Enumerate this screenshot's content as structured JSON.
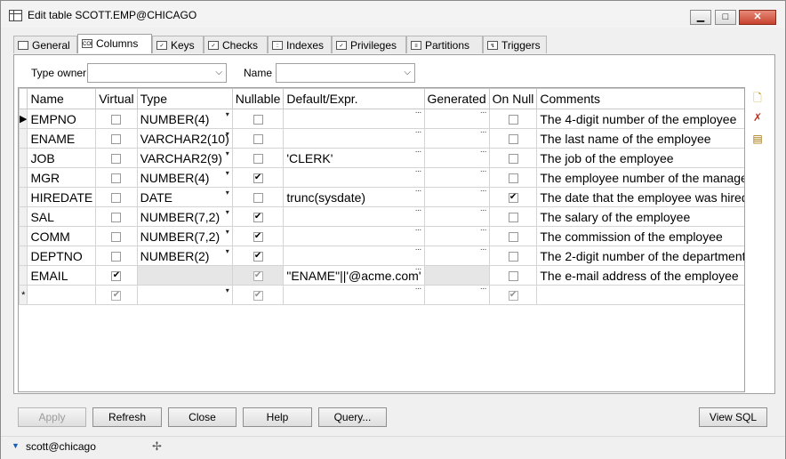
{
  "window": {
    "title": "Edit table SCOTT.EMP@CHICAGO",
    "minimize": "▁",
    "maximize": "□",
    "close": "✕"
  },
  "tabs": [
    {
      "label": "General",
      "icon": "general-icon",
      "glyph": ""
    },
    {
      "label": "Columns",
      "icon": "columns-icon",
      "glyph": "COL"
    },
    {
      "label": "Keys",
      "icon": "keys-icon",
      "glyph": "✓"
    },
    {
      "label": "Checks",
      "icon": "checks-icon",
      "glyph": "✓"
    },
    {
      "label": "Indexes",
      "icon": "indexes-icon",
      "glyph": "::"
    },
    {
      "label": "Privileges",
      "icon": "privileges-icon",
      "glyph": "✓"
    },
    {
      "label": "Partitions",
      "icon": "partitions-icon",
      "glyph": "≡"
    },
    {
      "label": "Triggers",
      "icon": "triggers-icon",
      "glyph": "↯"
    }
  ],
  "filters": {
    "type_owner_label": "Type owner",
    "type_owner_value": "",
    "name_label": "Name",
    "name_value": ""
  },
  "grid": {
    "headers": [
      "Name",
      "Virtual",
      "Type",
      "Nullable",
      "Default/Expr.",
      "Generated",
      "On Null",
      "Comments"
    ],
    "rows": [
      {
        "indicator": "▶",
        "name": "EMPNO",
        "virtual": false,
        "type": "NUMBER(4)",
        "nullable": false,
        "default": "",
        "generated": "",
        "on_null": false,
        "comments": "The 4-digit number of the employee"
      },
      {
        "indicator": "",
        "name": "ENAME",
        "virtual": false,
        "type": "VARCHAR2(10)",
        "nullable": false,
        "default": "",
        "generated": "",
        "on_null": false,
        "comments": "The last name of the employee"
      },
      {
        "indicator": "",
        "name": "JOB",
        "virtual": false,
        "type": "VARCHAR2(9)",
        "nullable": false,
        "default": "'CLERK'",
        "generated": "",
        "on_null": false,
        "comments": "The job of the employee"
      },
      {
        "indicator": "",
        "name": "MGR",
        "virtual": false,
        "type": "NUMBER(4)",
        "nullable": true,
        "default": "",
        "generated": "",
        "on_null": false,
        "comments": "The employee number of the manager"
      },
      {
        "indicator": "",
        "name": "HIREDATE",
        "virtual": false,
        "type": "DATE",
        "nullable": false,
        "default": "trunc(sysdate)",
        "generated": "",
        "on_null": true,
        "comments": "The date that the employee was hired"
      },
      {
        "indicator": "",
        "name": "SAL",
        "virtual": false,
        "type": "NUMBER(7,2)",
        "nullable": true,
        "default": "",
        "generated": "",
        "on_null": false,
        "comments": "The salary of the employee"
      },
      {
        "indicator": "",
        "name": "COMM",
        "virtual": false,
        "type": "NUMBER(7,2)",
        "nullable": true,
        "default": "",
        "generated": "",
        "on_null": false,
        "comments": "The commission of the employee"
      },
      {
        "indicator": "",
        "name": "DEPTNO",
        "virtual": false,
        "type": "NUMBER(2)",
        "nullable": true,
        "default": "",
        "generated": "",
        "on_null": false,
        "comments": "The 2-digit number of the department"
      },
      {
        "indicator": "",
        "name": "EMAIL",
        "virtual": true,
        "type": "",
        "nullable": true,
        "default": "\"ENAME\"||'@acme.com'",
        "generated": "",
        "on_null": false,
        "comments": "The e-mail address of the employee"
      },
      {
        "indicator": "*",
        "name": "",
        "virtual": true,
        "type": "",
        "nullable": true,
        "default": "",
        "generated": "",
        "on_null": true,
        "comments": ""
      }
    ]
  },
  "side_icons": [
    "add-column-icon",
    "delete-column-icon",
    "column-properties-icon"
  ],
  "buttons": {
    "apply": "Apply",
    "refresh": "Refresh",
    "close": "Close",
    "help": "Help",
    "query": "Query...",
    "view_sql": "View SQL"
  },
  "status": {
    "connection": "scott@chicago"
  }
}
